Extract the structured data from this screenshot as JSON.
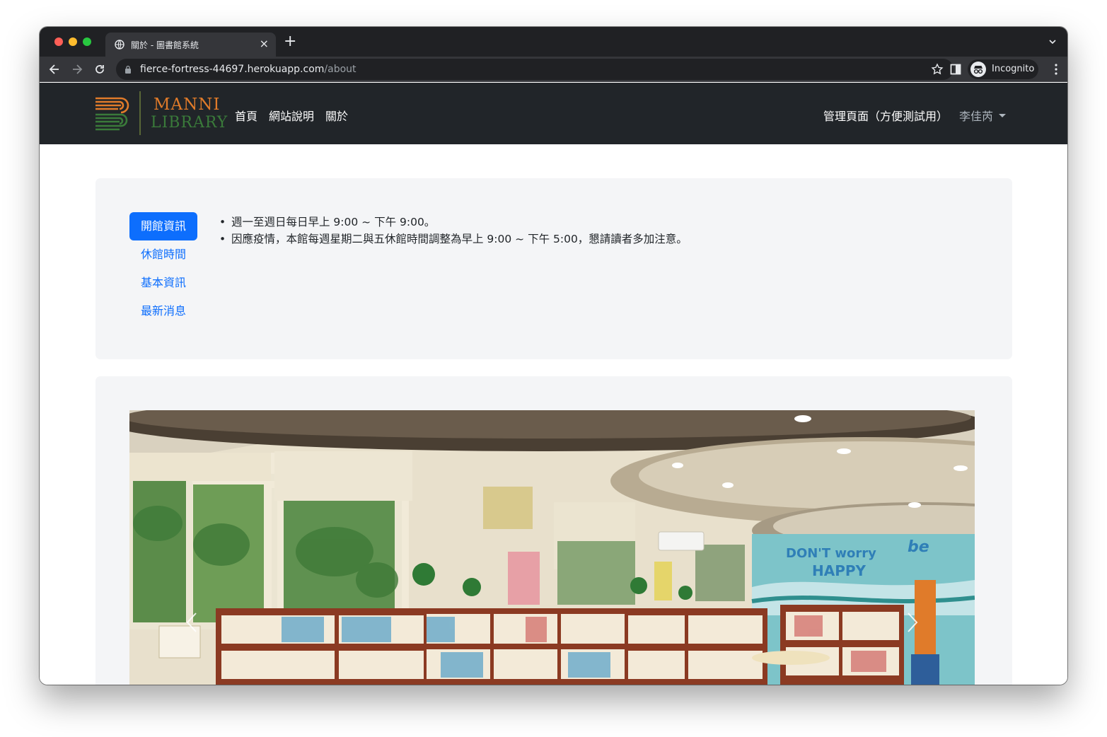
{
  "browser": {
    "tab_title": "關於 - 圖書館系統",
    "tab_close": "×",
    "new_tab": "+",
    "url_host": "fierce-fortress-44697.herokuapp.com",
    "url_path": "/about",
    "incognito_label": "Incognito"
  },
  "navbar": {
    "logo_line1": "MANNI",
    "logo_line2": "LIBRARY",
    "links": [
      "首頁",
      "網站說明",
      "關於"
    ],
    "admin_link": "管理頁面（方便測試用）",
    "user_name": "李佳芮"
  },
  "info_panel": {
    "tabs": [
      "開館資訊",
      "休館時間",
      "基本資訊",
      "最新消息"
    ],
    "active_tab": "開館資訊",
    "items": [
      "週一至週日每日早上 9:00 ~ 下午 9:00。",
      "因應疫情，本館每週星期二與五休館時間調整為早上 9:00 ~ 下午 5:00，懇請讀者多加注意。"
    ]
  },
  "photo_sign": {
    "line1": "DON'T worry",
    "line2": "be",
    "line3": "HAPPY"
  },
  "colors": {
    "navbar_bg": "#212529",
    "primary": "#0d6efd",
    "card_bg": "#f4f5f7",
    "logo_orange": "#e07b2a",
    "logo_green": "#3a7a3a"
  }
}
